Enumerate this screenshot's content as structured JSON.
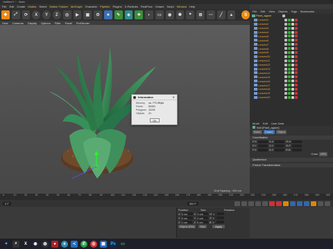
{
  "window": {
    "title": "Untitled 1 * - Main"
  },
  "menu": [
    "File",
    "Edit",
    "Create",
    "Modes",
    "Select",
    "Motion Tracker",
    "MoGraph",
    "Character",
    "Pipeline",
    "Plugins",
    "X-Particles",
    "RealFlow",
    "Octane",
    "Script",
    "Window",
    "Help"
  ],
  "toolbar": {
    "axis_buttons": [
      "X",
      "Y",
      "Z"
    ],
    "gear_icon_label": "S"
  },
  "viewport": {
    "menu": [
      "View",
      "Cameras",
      "Display",
      "Options",
      "Filter",
      "Panel",
      "ProRender"
    ],
    "grid_spacing": "Grid Spacing : 100 cm"
  },
  "objects": {
    "tabs": [
      "File",
      "Edit",
      "View",
      "Objects",
      "Tags",
      "Bookmarks"
    ],
    "root": "Plant_agave",
    "items": [
      "Leaves1",
      "Leaves2",
      "Leaves3",
      "Leaves4",
      "Leaves5",
      "Leaves6",
      "Leaves7",
      "Leaves8",
      "Leaves9",
      "Leaves10",
      "Leaves11",
      "Leaves12",
      "Leaves13",
      "Leaves14",
      "Leaves15",
      "Leaves16",
      "Leaves17",
      "Leaves18",
      "Leaves19",
      "Leaves20"
    ]
  },
  "attributes": {
    "tabs": [
      "Mode",
      "Edit",
      "User Data"
    ],
    "object_title": "Null [Plant_agave]",
    "subtabs": [
      "Basic",
      "Coord.",
      "Object"
    ],
    "section": "Coordinates",
    "order_label": "Order",
    "order_value": "HPB",
    "extra_sections": [
      "Quaternion",
      "Freeze Transformation"
    ]
  },
  "timeline": {
    "ticks": [
      "0",
      "10",
      "20",
      "30",
      "40",
      "50",
      "60",
      "70",
      "80",
      "90",
      "100",
      "110",
      "120",
      "130",
      "140",
      "150",
      "160",
      "170",
      "180",
      "190",
      "200",
      "210",
      "220",
      "230",
      "240",
      "250",
      "260",
      "270",
      "280",
      "290",
      "300"
    ],
    "frame_start": "0 F",
    "frame_end": "300 F"
  },
  "coordinates": {
    "headers": [
      "Position",
      "Size",
      "Rotation"
    ],
    "rows": [
      {
        "axis": "X",
        "pos": "0 cm",
        "size": "0 cm",
        "rot_label": "H",
        "rot": "0 °"
      },
      {
        "axis": "Y",
        "pos": "0 cm",
        "size": "0 cm",
        "rot_label": "P",
        "rot": "0 °"
      },
      {
        "axis": "Z",
        "pos": "0 cm",
        "size": "0 cm",
        "rot_label": "B",
        "rot": "0 °"
      }
    ],
    "mode_left": "Object (Rel)",
    "mode_mid": "Size",
    "apply": "Apply"
  },
  "info_dialog": {
    "title": "Information",
    "rows": [
      {
        "k": "Memory",
        "v": "ca. 770 KByte"
      },
      {
        "k": "Points",
        "v": "50391"
      },
      {
        "k": "Polygons",
        "v": "11194"
      },
      {
        "k": "Objects",
        "v": "21"
      }
    ],
    "ok": "OK"
  },
  "taskbar_apps": [
    "start",
    "search",
    "x",
    "c4d",
    "obs",
    "record",
    "edge",
    "vscode",
    "whatsapp",
    "chrome",
    "store",
    "photoshop",
    "cinema"
  ]
}
